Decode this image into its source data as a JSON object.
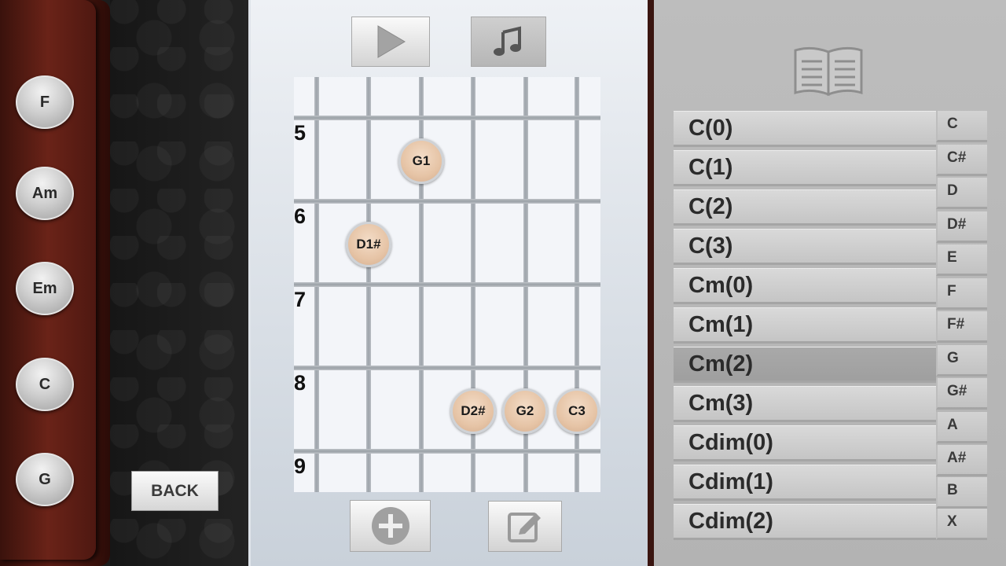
{
  "chord_buttons": [
    "F",
    "Am",
    "Em",
    "C",
    "G"
  ],
  "back_label": "BACK",
  "toolbar": {
    "play_icon": "play-icon",
    "music_icon": "music-note-icon",
    "add_icon": "plus-circle-icon",
    "edit_icon": "edit-icon"
  },
  "fret_numbers": [
    "5",
    "6",
    "7",
    "8",
    "9"
  ],
  "notes": [
    "G1",
    "D1#",
    "D2#",
    "G2",
    "C3"
  ],
  "chord_list": [
    "C(0)",
    "C(1)",
    "C(2)",
    "C(3)",
    "Cm(0)",
    "Cm(1)",
    "Cm(2)",
    "Cm(3)",
    "Cdim(0)",
    "Cdim(1)",
    "Cdim(2)"
  ],
  "selected_chord": "Cm(2)",
  "key_list": [
    "C",
    "C#",
    "D",
    "D#",
    "E",
    "F",
    "F#",
    "G",
    "G#",
    "A",
    "A#",
    "B",
    "X"
  ],
  "colors": {
    "wood": "#5a1c14",
    "note_fill": "#e6c4a6",
    "selected_row": "#a5a5a5"
  }
}
